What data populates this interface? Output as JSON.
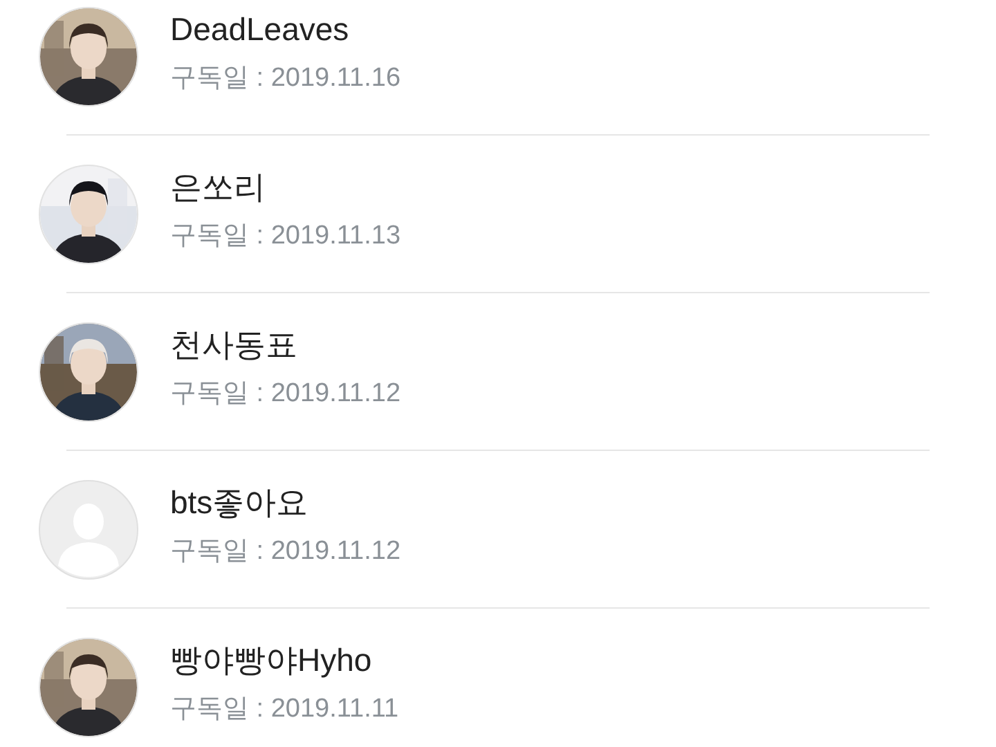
{
  "subscribers": [
    {
      "name": "DeadLeaves",
      "date": "구독일 : 2019.11.16"
    },
    {
      "name": "은쏘리",
      "date": "구독일 : 2019.11.13"
    },
    {
      "name": "천사동표",
      "date": "구독일 : 2019.11.12"
    },
    {
      "name": "bts좋아요",
      "date": "구독일 : 2019.11.12",
      "avatar": {
        "kind": "default"
      }
    },
    {
      "name": "빵야빵야Hyho",
      "date": "구독일 : 2019.11.11"
    }
  ]
}
